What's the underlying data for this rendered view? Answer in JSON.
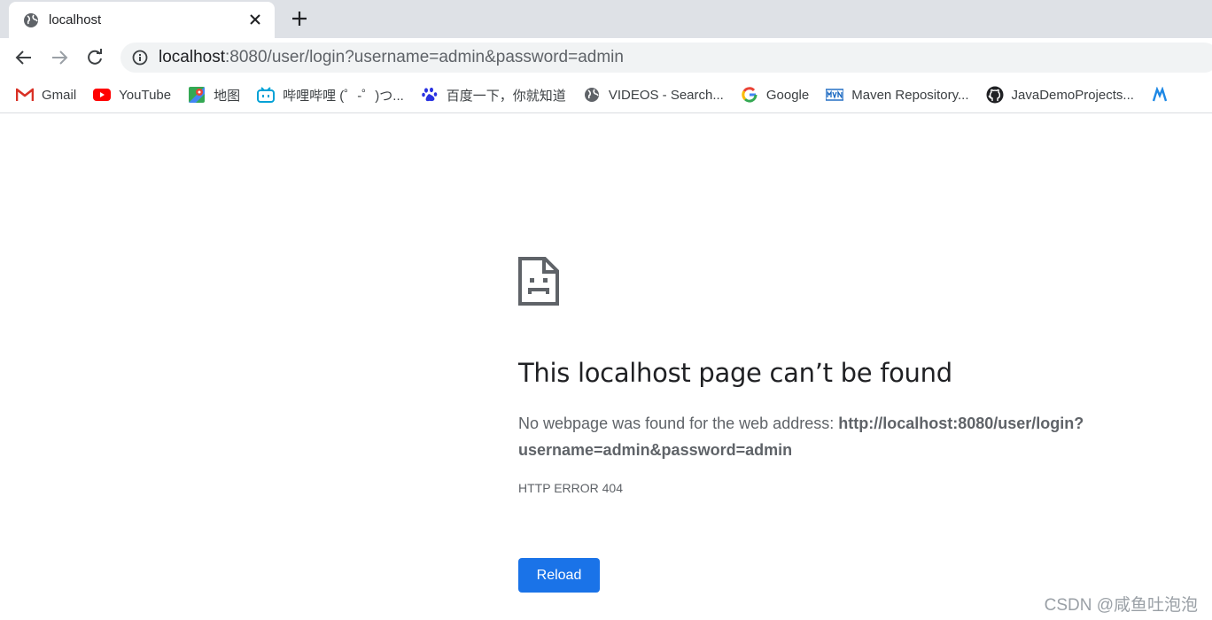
{
  "tab": {
    "title": "localhost",
    "favicon": "globe-icon"
  },
  "omnibox": {
    "url_host": "localhost",
    "url_rest": ":8080/user/login?username=admin&password=admin"
  },
  "bookmarks": [
    {
      "label": "Gmail",
      "icon": "gmail-icon"
    },
    {
      "label": "YouTube",
      "icon": "youtube-icon"
    },
    {
      "label": "地图",
      "icon": "maps-icon"
    },
    {
      "label": "哔哩哔哩 (゜-゜)つ...",
      "icon": "bilibili-icon"
    },
    {
      "label": "百度一下，你就知道",
      "icon": "baidu-icon"
    },
    {
      "label": "VIDEOS - Search...",
      "icon": "globe-icon"
    },
    {
      "label": "Google",
      "icon": "google-icon"
    },
    {
      "label": "Maven Repository...",
      "icon": "maven-icon"
    },
    {
      "label": "JavaDemoProjects...",
      "icon": "github-icon"
    }
  ],
  "error": {
    "heading": "This localhost page can’t be found",
    "desc_prefix": "No webpage was found for the web address: ",
    "address": "http://localhost:8080/user/login?username=admin&password=admin",
    "code": "HTTP ERROR 404",
    "reload_label": "Reload"
  },
  "watermark": "CSDN @咸鱼吐泡泡",
  "colors": {
    "accent": "#1a73e8",
    "tabstrip": "#dee1e6",
    "omnibox": "#f1f3f4"
  }
}
